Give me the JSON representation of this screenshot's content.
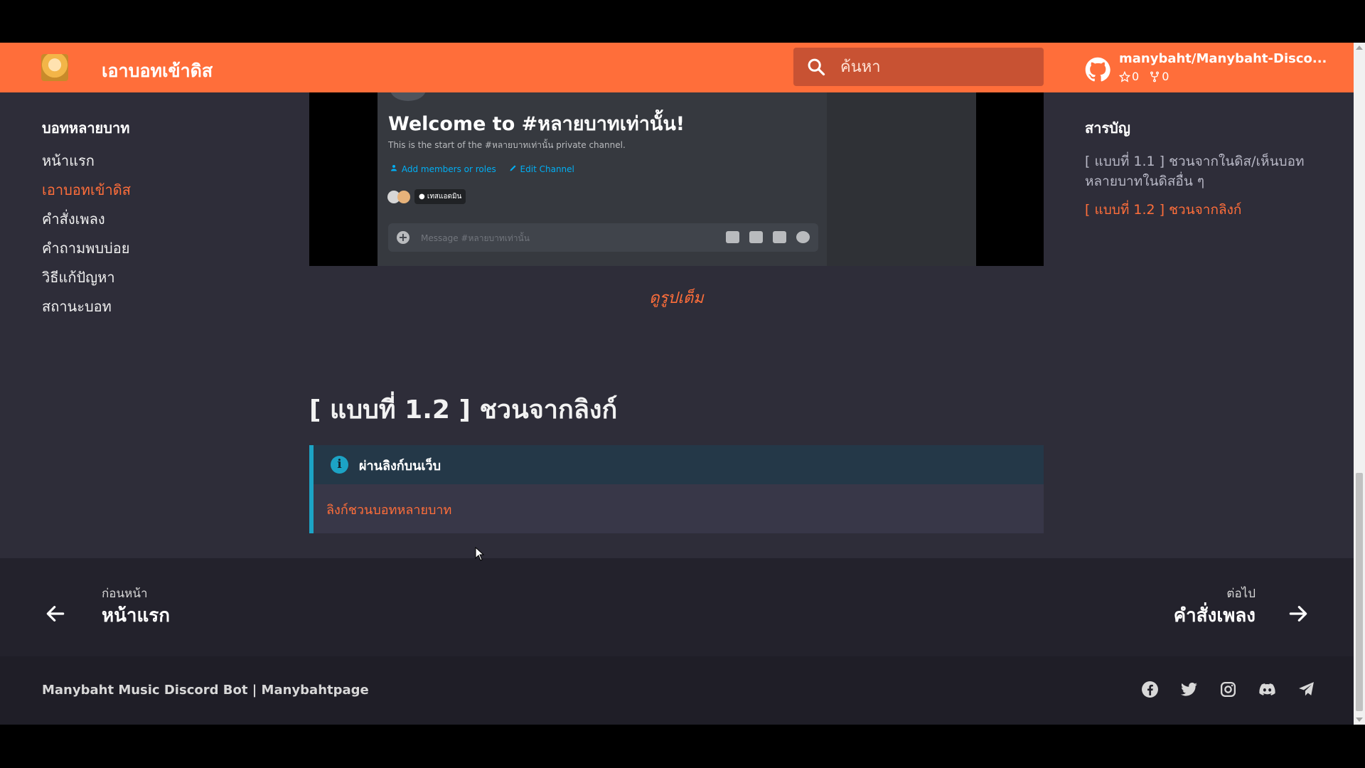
{
  "header": {
    "site_title": "เอาบอทเข้าดิส",
    "search_placeholder": "ค้นหา",
    "repo_name": "manybaht/Manybaht-Disco...",
    "stars": "0",
    "forks": "0",
    "accent_color": "#ff6e3a"
  },
  "left_nav": {
    "heading": "บอทหลายบาท",
    "items": [
      {
        "label": "หน้าแรก",
        "active": false
      },
      {
        "label": "เอาบอทเข้าดิส",
        "active": true
      },
      {
        "label": "คำสั่งเพลง",
        "active": false
      },
      {
        "label": "คำถามพบบ่อย",
        "active": false
      },
      {
        "label": "วิธีแก้ปัญหา",
        "active": false
      },
      {
        "label": "สถานะบอท",
        "active": false
      }
    ]
  },
  "embedded_screenshot": {
    "title": "Welcome to #หลายบาทเท่านั้น!",
    "subtitle": "This is the start of the #หลายบาทเท่านั้น private channel.",
    "add_members": "Add members or roles",
    "edit_channel": "Edit Channel",
    "role_chip": "● เทสแอดมิน",
    "message_placeholder": "Message #หลายบาทเท่านั้น"
  },
  "content": {
    "view_full_link": "ดูรูปเต็ม",
    "section_heading": "[ แบบที่ 1.2 ] ชวนจากลิงก์",
    "callout_title": "ผ่านลิงก์บนเว็บ",
    "callout_link": "ลิงก์ชวนบอทหลายบาท"
  },
  "toc": {
    "heading": "สารบัญ",
    "items": [
      {
        "label": "[ แบบที่ 1.1 ] ชวนจากในดิส/เห็นบอทหลายบาทในดิสอื่น ๆ",
        "active": false
      },
      {
        "label": "[ แบบที่ 1.2 ] ชวนจากลิงก์",
        "active": true
      }
    ]
  },
  "pager": {
    "prev_label": "ก่อนหน้า",
    "prev_title": "หน้าแรก",
    "next_label": "ต่อไป",
    "next_title": "คำสั่งเพลง"
  },
  "footer": {
    "text": "Manybaht Music Discord Bot | Manybahtpage",
    "socials": [
      "facebook-icon",
      "twitter-icon",
      "instagram-icon",
      "discord-icon",
      "telegram-icon"
    ]
  }
}
